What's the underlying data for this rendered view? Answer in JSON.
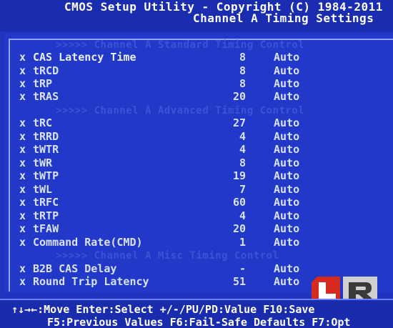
{
  "header": {
    "title": "CMOS Setup Utility - Copyright (C) 1984-2011",
    "subtitle": "Channel A Timing Settings"
  },
  "sections": [
    {
      "label": ">>>>> Channel A Standard Timing Control"
    },
    {
      "label": ">>>>> Channel A Advanced Timing Control"
    },
    {
      "label": ">>>>> Channel A Misc Timing Control"
    }
  ],
  "items": [
    {
      "mark": "x",
      "label": "CAS Latency Time",
      "value": "8",
      "setting": "Auto"
    },
    {
      "mark": "x",
      "label": "tRCD",
      "value": "8",
      "setting": "Auto"
    },
    {
      "mark": "x",
      "label": "tRP",
      "value": "8",
      "setting": "Auto"
    },
    {
      "mark": "x",
      "label": "tRAS",
      "value": "20",
      "setting": "Auto"
    },
    {
      "mark": "x",
      "label": "tRC",
      "value": "27",
      "setting": "Auto"
    },
    {
      "mark": "x",
      "label": "tRRD",
      "value": "4",
      "setting": "Auto"
    },
    {
      "mark": "x",
      "label": "tWTR",
      "value": "4",
      "setting": "Auto"
    },
    {
      "mark": "x",
      "label": "tWR",
      "value": "8",
      "setting": "Auto"
    },
    {
      "mark": "x",
      "label": "tWTP",
      "value": "19",
      "setting": "Auto"
    },
    {
      "mark": "x",
      "label": "tWL",
      "value": "7",
      "setting": "Auto"
    },
    {
      "mark": "x",
      "label": "tRFC",
      "value": "60",
      "setting": "Auto"
    },
    {
      "mark": "x",
      "label": "tRTP",
      "value": "4",
      "setting": "Auto"
    },
    {
      "mark": "x",
      "label": "tFAW",
      "value": "20",
      "setting": "Auto"
    },
    {
      "mark": "x",
      "label": "Command Rate(CMD)",
      "value": "1",
      "setting": "Auto"
    },
    {
      "mark": "x",
      "label": "B2B CAS Delay",
      "value": "-",
      "setting": "Auto"
    },
    {
      "mark": "x",
      "label": "Round Trip Latency",
      "value": "51",
      "setting": "Auto"
    }
  ],
  "footer": {
    "line1": "↑↓→←:Move   Enter:Select   +/-/PU/PD:Value   F10:Save",
    "line2": "F5:Previous Values   F6:Fail-Safe Defaults   F7:Opt"
  },
  "colors": {
    "background": "#1f33be",
    "header_bg": "#1a2db0",
    "text": "#d8e2ff",
    "section_text": "#3b53d6",
    "logo_red": "#d62a1e",
    "logo_gray": "#cfcfcf"
  },
  "logo": {
    "icon": "legit-reviews-logo-icon"
  }
}
